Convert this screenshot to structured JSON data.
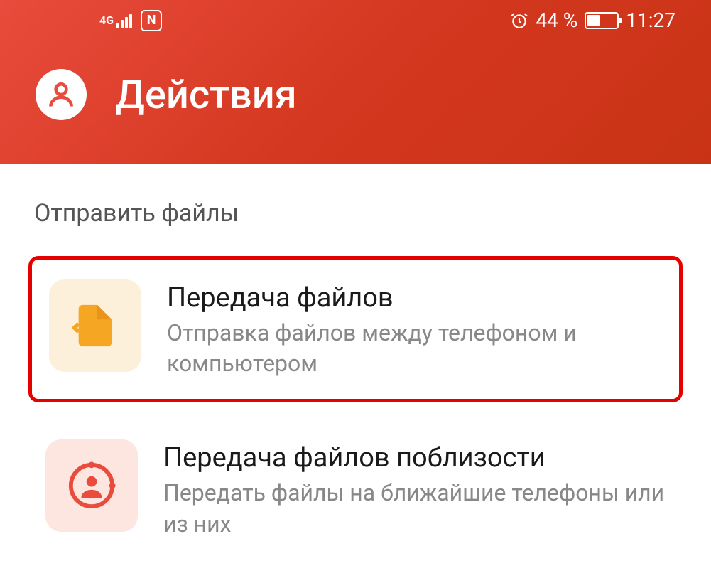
{
  "status": {
    "network": "4G",
    "nfc": "N",
    "battery_text": "44 %",
    "time": "11:27"
  },
  "header": {
    "title": "Действия"
  },
  "section": {
    "title": "Отправить файлы"
  },
  "options": [
    {
      "title": "Передача файлов",
      "desc": "Отправка файлов между телефоном и компьютером"
    },
    {
      "title": "Передача файлов поблизости",
      "desc": "Передать файлы на ближайшие телефоны или из них"
    }
  ]
}
